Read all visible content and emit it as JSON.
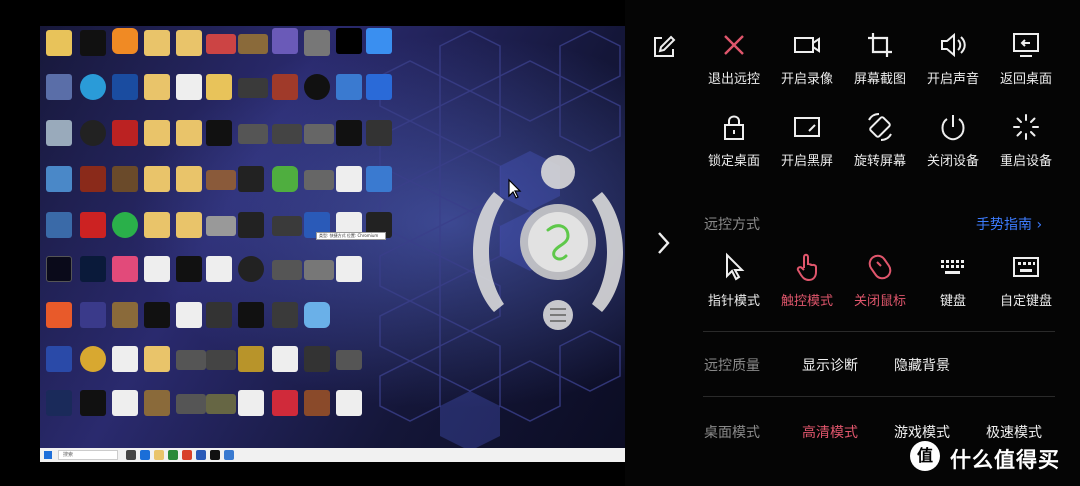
{
  "panel": {
    "actions_row1": [
      {
        "label": "退出远控",
        "icon": "close-x-icon"
      },
      {
        "label": "开启录像",
        "icon": "video-camera-icon"
      },
      {
        "label": "屏幕截图",
        "icon": "crop-icon"
      },
      {
        "label": "开启声音",
        "icon": "speaker-icon"
      },
      {
        "label": "返回桌面",
        "icon": "monitor-return-icon"
      }
    ],
    "actions_row2": [
      {
        "label": "锁定桌面",
        "icon": "lock-icon"
      },
      {
        "label": "开启黑屏",
        "icon": "screen-dark-icon"
      },
      {
        "label": "旋转屏幕",
        "icon": "rotate-icon"
      },
      {
        "label": "关闭设备",
        "icon": "power-icon"
      },
      {
        "label": "重启设备",
        "icon": "loading-spinner-icon"
      }
    ],
    "control_mode": {
      "title": "远控方式",
      "guide": "手势指南 ›",
      "modes": [
        {
          "label": "指针模式",
          "icon": "pointer-icon",
          "active": false
        },
        {
          "label": "触控模式",
          "icon": "touch-hand-icon",
          "active": true
        },
        {
          "label": "关闭鼠标",
          "icon": "mouse-off-icon",
          "active": true
        },
        {
          "label": "键盘",
          "icon": "keyboard-icon",
          "active": false
        },
        {
          "label": "自定键盘",
          "icon": "custom-keyboard-icon",
          "active": false
        }
      ]
    },
    "quality": {
      "title": "远控质量",
      "options": [
        "显示诊断",
        "隐藏背景"
      ]
    },
    "desktop_mode": {
      "title": "桌面模式",
      "options": [
        {
          "label": "高清模式",
          "active": true
        },
        {
          "label": "游戏模式",
          "active": false
        },
        {
          "label": "极速模式",
          "active": false
        }
      ]
    }
  },
  "desktop": {
    "search_placeholder": "搜索",
    "tooltip": "类型: 快捷方式 位置: Chromium"
  },
  "watermark": {
    "logo_char": "值",
    "text": "什么值得买"
  },
  "colors": {
    "accent_red": "#e0566c",
    "link_blue": "#3d7cff",
    "panel_bg": "#050505"
  }
}
